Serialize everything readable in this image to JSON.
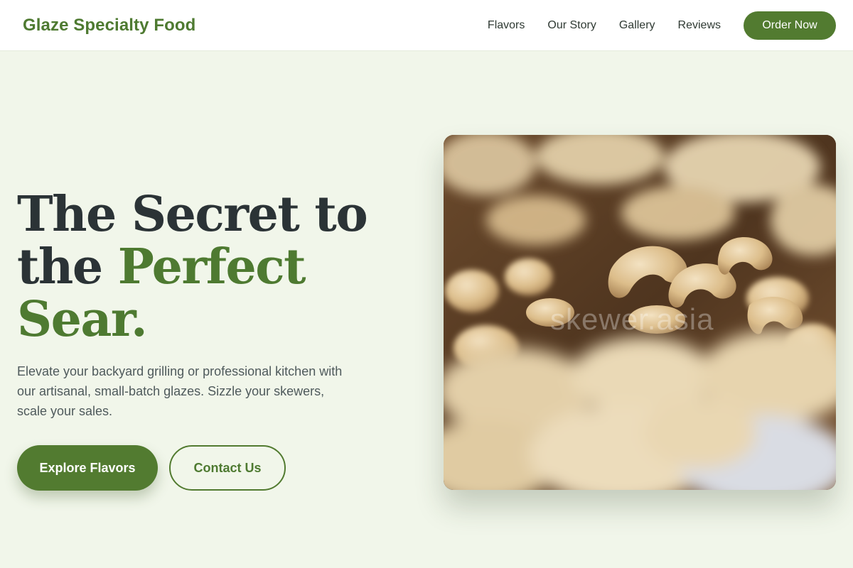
{
  "header": {
    "brand": "Glaze Specialty Food",
    "nav": [
      "Flavors",
      "Our Story",
      "Gallery",
      "Reviews"
    ],
    "order_label": "Order Now"
  },
  "hero": {
    "headline_line1": "The Secret to",
    "headline_line2_prefix": "the ",
    "headline_line2_accent": "Perfect Sear.",
    "subtext": "Elevate your backyard grilling or professional kitchen with our artisanal, small-batch glazes. Sizzle your skewers, scale your sales.",
    "primary_cta": "Explore Flavors",
    "secondary_cta": "Contact Us"
  },
  "image": {
    "alt": "cashew-nuts-photo",
    "watermark": "skewer.asia"
  },
  "colors": {
    "brand_green": "#527b30",
    "page_bg": "#f1f6ea",
    "heading": "#2b3336"
  }
}
